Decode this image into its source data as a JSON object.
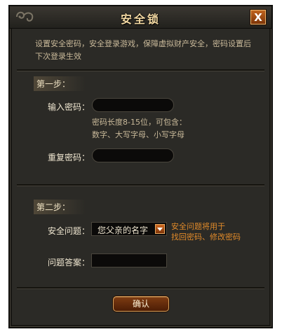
{
  "dialog": {
    "title": "安全锁",
    "close_label": "X",
    "description": "设置安全密码，安全登录游戏，保障虚拟财产安全，密码设置后下次登录生效"
  },
  "step1": {
    "title": "第一步：",
    "password_label": "输入密码：",
    "password_value": "",
    "hint_line1": "密码长度8-15位，可包含：",
    "hint_line2": "数字、大写字母、小写字母",
    "repeat_label": "重复密码：",
    "repeat_value": ""
  },
  "step2": {
    "title": "第二步：",
    "question_label": "安全问题：",
    "question_selected": "您父亲的名字",
    "question_hint_line1": "安全问题将用于",
    "question_hint_line2": "找回密码、修改密码",
    "answer_label": "问题答案：",
    "answer_value": ""
  },
  "actions": {
    "confirm_label": "确认"
  },
  "icons": {
    "title_ornament": "swirl-ornament-icon",
    "close": "close-icon",
    "dropdown": "chevron-down-icon"
  },
  "colors": {
    "panel_bg": "#2b2a26",
    "title_text": "#f3d9a3",
    "hint_orange": "#e08a2a",
    "close_button": "#b0561a"
  }
}
